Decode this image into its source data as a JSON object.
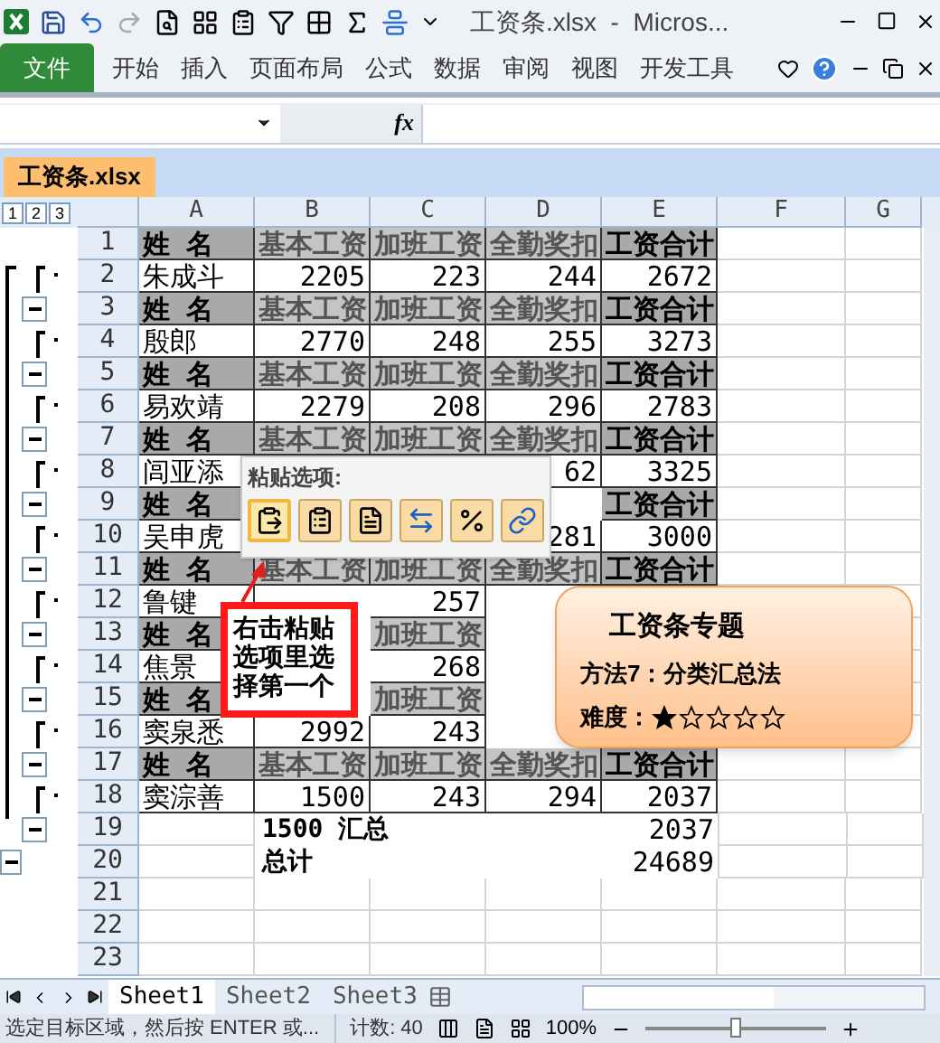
{
  "window": {
    "title": "工资条.xlsx  -  Micros..."
  },
  "ribbon": {
    "file_tab": "文件",
    "tabs": [
      {
        "label": "开始",
        "selected": false
      },
      {
        "label": "插入",
        "selected": false
      },
      {
        "label": "页面布局",
        "selected": false
      },
      {
        "label": "公式",
        "selected": false
      },
      {
        "label": "数据",
        "selected": false
      },
      {
        "label": "审阅",
        "selected": false
      },
      {
        "label": "视图",
        "selected": false
      },
      {
        "label": "开发工具",
        "selected": false
      }
    ]
  },
  "formula_bar": {
    "function_label": "fx"
  },
  "workbook_tab": "工资条.xlsx",
  "outline_levels": [
    "1",
    "2",
    "3"
  ],
  "columns": [
    "A",
    "B",
    "C",
    "D",
    "E",
    "F",
    "G"
  ],
  "rows": [
    {
      "number": "1",
      "kind": "header",
      "cells": [
        "姓 名",
        "基本工资",
        "加班工资",
        "全勤奖扣",
        "工资合计"
      ]
    },
    {
      "number": "2",
      "kind": "data",
      "cells": [
        "朱成斗",
        "2205",
        "223",
        "244",
        "2672"
      ]
    },
    {
      "number": "3",
      "kind": "header",
      "cells": [
        "姓 名",
        "基本工资",
        "加班工资",
        "全勤奖扣",
        "工资合计"
      ]
    },
    {
      "number": "4",
      "kind": "data",
      "cells": [
        "殷郎",
        "2770",
        "248",
        "255",
        "3273"
      ]
    },
    {
      "number": "5",
      "kind": "header",
      "cells": [
        "姓 名",
        "基本工资",
        "加班工资",
        "全勤奖扣",
        "工资合计"
      ]
    },
    {
      "number": "6",
      "kind": "data",
      "cells": [
        "易欢靖",
        "2279",
        "208",
        "296",
        "2783"
      ]
    },
    {
      "number": "7",
      "kind": "header",
      "cells": [
        "姓 名",
        "基本工资",
        "加班工资",
        "全勤奖扣",
        "工资合计"
      ]
    },
    {
      "number": "8",
      "kind": "data",
      "cells": [
        "闾亚添",
        null,
        null,
        "62",
        "3325"
      ]
    },
    {
      "number": "9",
      "kind": "header",
      "cells": [
        "姓 名",
        null,
        null,
        null,
        "工资合计"
      ]
    },
    {
      "number": "10",
      "kind": "data",
      "cells": [
        "吴申虎",
        null,
        null,
        "281",
        "3000"
      ]
    },
    {
      "number": "11",
      "kind": "header",
      "cells": [
        "姓 名",
        "基本工资",
        "加班工资",
        "全勤奖扣",
        "工资合计"
      ]
    },
    {
      "number": "12",
      "kind": "data",
      "cells": [
        "鲁键",
        null,
        "257",
        null,
        null
      ]
    },
    {
      "number": "13",
      "kind": "header",
      "cells": [
        "姓 名",
        null,
        "加班工资",
        null,
        null
      ]
    },
    {
      "number": "14",
      "kind": "data",
      "cells": [
        "焦景",
        null,
        "268",
        null,
        null
      ]
    },
    {
      "number": "15",
      "kind": "header",
      "cells": [
        "姓 名",
        null,
        "加班工资",
        null,
        null
      ]
    },
    {
      "number": "16",
      "kind": "data",
      "cells": [
        "窦泉悉",
        "2992",
        "243",
        null,
        null
      ]
    },
    {
      "number": "17",
      "kind": "header",
      "cells": [
        "姓 名",
        "基本工资",
        "加班工资",
        "全勤奖扣",
        "工资合计"
      ]
    },
    {
      "number": "18",
      "kind": "data",
      "cells": [
        "窦淙善",
        "1500",
        "243",
        "294",
        "2037"
      ]
    },
    {
      "number": "19",
      "kind": "subtotal",
      "label": "1500 汇总",
      "total": "2037"
    },
    {
      "number": "20",
      "kind": "total",
      "label": "总计",
      "total": "24689"
    },
    {
      "number": "21",
      "kind": "empty"
    },
    {
      "number": "22",
      "kind": "empty"
    },
    {
      "number": "23",
      "kind": "empty"
    }
  ],
  "paste_options": {
    "title": "粘贴选项:",
    "options": [
      {
        "kind": "paste",
        "selected": true
      },
      {
        "kind": "values",
        "selected": false
      },
      {
        "kind": "formulas",
        "selected": false
      },
      {
        "kind": "transpose",
        "selected": false
      },
      {
        "kind": "formatting",
        "selected": false
      },
      {
        "kind": "link",
        "selected": false
      }
    ]
  },
  "callout": {
    "text": "右击粘贴选项里选择第一个"
  },
  "note": {
    "title": "工资条专题",
    "method": "方法7：分类汇总法",
    "difficulty_label": "难度：",
    "stars": 1
  },
  "sheets": [
    {
      "label": "Sheet1",
      "selected": true
    },
    {
      "label": "Sheet2",
      "selected": false
    },
    {
      "label": "Sheet3",
      "selected": false
    }
  ],
  "status_bar": {
    "message": "选定目标区域，然后按 ENTER 或...",
    "count": "计数: 40",
    "zoom": {
      "reading": "100%",
      "level": 0.5
    }
  }
}
